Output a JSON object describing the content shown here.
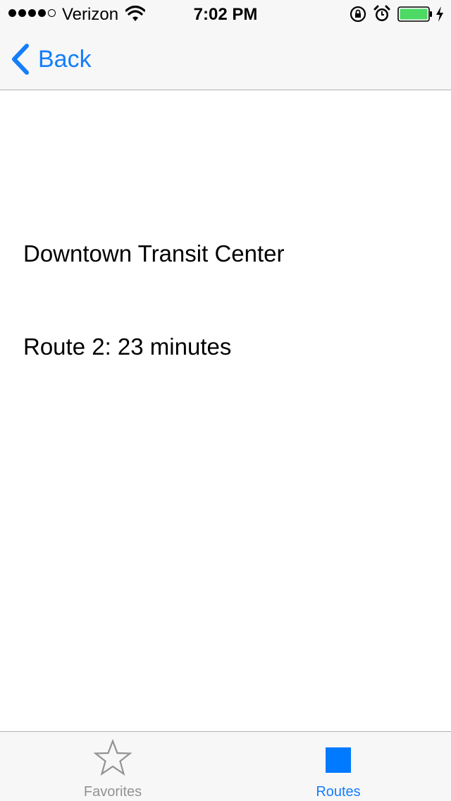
{
  "status_bar": {
    "carrier": "Verizon",
    "time": "7:02 PM",
    "signal_bars_filled": 4,
    "signal_bars_total": 5,
    "battery_level": 1.0
  },
  "nav": {
    "back_label": "Back",
    "back_icon": "chevron-left-icon"
  },
  "content": {
    "station_name": "Downtown Transit Center",
    "route_info": "Route 2: 23 minutes"
  },
  "tabs": [
    {
      "label": "Favorites",
      "icon": "star-icon",
      "selected": false
    },
    {
      "label": "Routes",
      "icon": "square-icon",
      "selected": true
    }
  ],
  "colors": {
    "accent": "#147efb",
    "tab_selected": "#007aff",
    "tab_unselected": "#929292",
    "battery": "#4cd964",
    "bar_background": "#f7f7f7"
  }
}
